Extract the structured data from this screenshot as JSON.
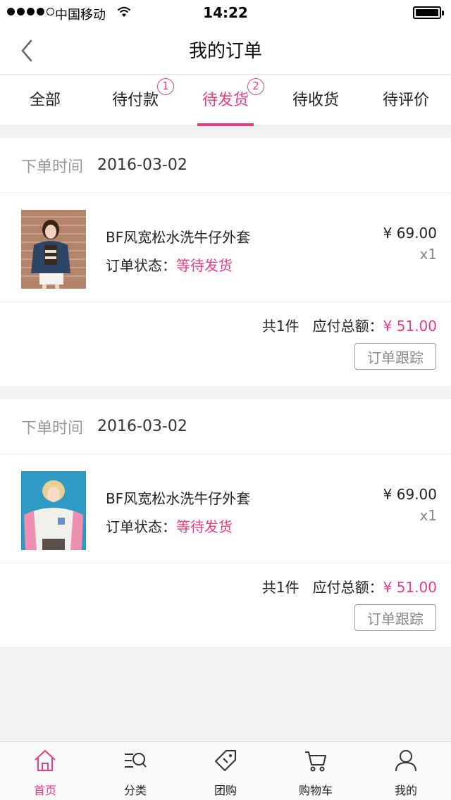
{
  "status_bar": {
    "carrier": "中国移动",
    "time": "14:22"
  },
  "header": {
    "title": "我的订单"
  },
  "tabs": [
    {
      "label": "全部",
      "badge": "",
      "active": false
    },
    {
      "label": "待付款",
      "badge": "1",
      "active": false
    },
    {
      "label": "待发货",
      "badge": "2",
      "active": true
    },
    {
      "label": "待收货",
      "badge": "",
      "active": false
    },
    {
      "label": "待评价",
      "badge": "",
      "active": false
    }
  ],
  "orders": [
    {
      "time_label": "下单时间",
      "date": "2016-03-02",
      "product_name": "BF风宽松水洗牛仔外套",
      "status_label": "订单状态：",
      "status_value": "等待发货",
      "price": "¥ 69.00",
      "quantity": "x1",
      "count_text": "共1件",
      "total_label": "应付总额：",
      "total_amount": "¥ 51.00",
      "track_label": "订单跟踪"
    },
    {
      "time_label": "下单时间",
      "date": "2016-03-02",
      "product_name": "BF风宽松水洗牛仔外套",
      "status_label": "订单状态：",
      "status_value": "等待发货",
      "price": "¥ 69.00",
      "quantity": "x1",
      "count_text": "共1件",
      "total_label": "应付总额：",
      "total_amount": "¥ 51.00",
      "track_label": "订单跟踪"
    }
  ],
  "bottom_nav": [
    {
      "label": "首页",
      "icon": "home-icon",
      "active": true
    },
    {
      "label": "分类",
      "icon": "category-search-icon",
      "active": false
    },
    {
      "label": "团购",
      "icon": "tag-icon",
      "active": false
    },
    {
      "label": "购物车",
      "icon": "cart-icon",
      "active": false
    },
    {
      "label": "我的",
      "icon": "user-icon",
      "active": false
    }
  ],
  "colors": {
    "accent": "#ee3d7c",
    "background": "#f2f2f2"
  }
}
